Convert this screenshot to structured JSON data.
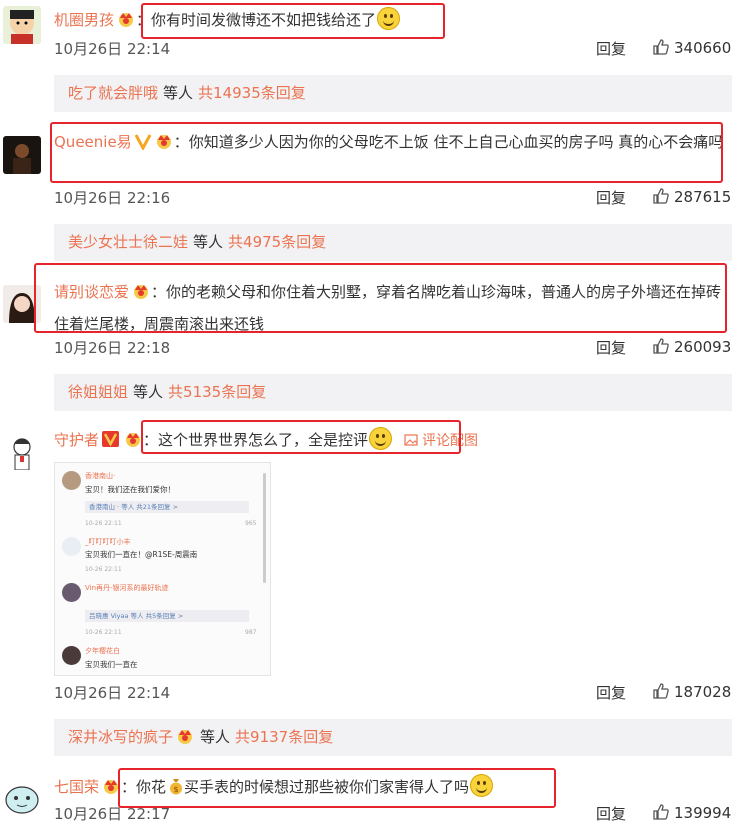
{
  "comments": [
    {
      "username": "机圈男孩",
      "text": "：你有时间发微博还不如把钱给还了",
      "time": "10月26日 22:14",
      "reply_label": "回复",
      "likes": "340660",
      "replies_bar": {
        "name": "吃了就会胖哦",
        "mid": "等人",
        "count": "共14935条回复"
      }
    },
    {
      "username": "Queenie易",
      "text": "：你知道多少人因为你的父母吃不上饭 住不上自己心血买的房子吗 真的心不会痛吗",
      "time": "10月26日 22:16",
      "reply_label": "回复",
      "likes": "287615",
      "replies_bar": {
        "name": "美少女壮士徐二娃",
        "mid": "等人",
        "count": "共4975条回复"
      }
    },
    {
      "username": "请别谈恋爱",
      "text": "：你的老赖父母和你住着大别墅，穿着名牌吃着山珍海味，普通人的房子外墙还在掉砖住着烂尾楼，周震南滚出来还钱",
      "time": "10月26日 22:18",
      "reply_label": "回复",
      "likes": "260093",
      "replies_bar": {
        "name": "徐姐姐姐",
        "mid": "等人",
        "count": "共5135条回复"
      }
    },
    {
      "username": "守护者",
      "text": "：这个世界世界怎么了，全是控评",
      "pic_link": "评论配图",
      "time": "10月26日 22:14",
      "reply_label": "回复",
      "likes": "187028",
      "replies_bar": {
        "name": "深井冰写的疯子",
        "mid": "等人",
        "count": "共9137条回复"
      }
    },
    {
      "username": "七国荣",
      "text_a": "：你花",
      "text_b": "买手表的时候想过那些被你们家害得人了吗",
      "time": "10月26日 22:17",
      "reply_label": "回复",
      "likes": "139994"
    }
  ],
  "thumbnail": {
    "c1_name": "香港南山·",
    "c1_text": "宝贝！我们还在我们爱你！",
    "c1_bar": "香港南山 · 等人  共21条回复 >",
    "c1_time": "10-26 22:11",
    "c1_likes": "965",
    "c2_name": "_叮叮叮叮小丰",
    "c2_text": "宝贝我们一直在！@R1SE-周震南",
    "c2_time": "10-26 22:11",
    "c3_name": "Vin再丹-银河系的最好轨迹",
    "c3_bar": "吕晓惠 Viyaa 等人  共5条回复 >",
    "c3_time": "10-26 22:11",
    "c3_likes": "987",
    "c4_name": "夕年樱花白",
    "c4_text": "宝贝我们一直在"
  },
  "colors": {
    "link": "#eb7350",
    "highlight_box": "#e5252b",
    "reply_bar_bg": "#f2f2f5"
  }
}
